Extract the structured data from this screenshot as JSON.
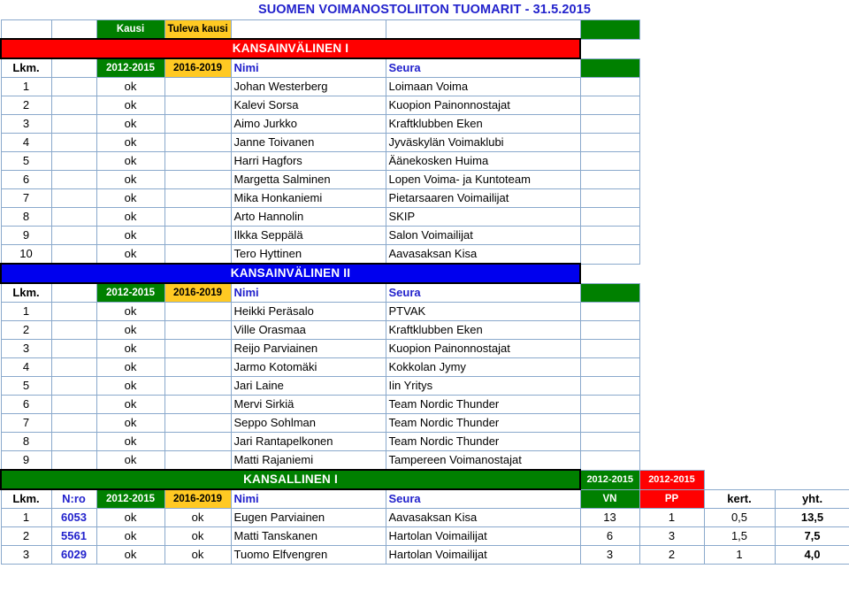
{
  "document": {
    "title": "SUOMEN VOIMANOSTOLIITON TUOMARIT - 31.5.2015"
  },
  "column_labels": {
    "lkm": "Lkm.",
    "nro": "N:ro",
    "kausi": "Kausi",
    "tuleva_kausi": "Tuleva kausi",
    "season_current": "2012-2015",
    "season_next": "2016-2019",
    "nimi": "Nimi",
    "seura": "Seura",
    "vn": "VN",
    "pp": "PP",
    "kert": "kert.",
    "yht": "yht.",
    "vn_season": "2012-2015",
    "pp_season": "2012-2015"
  },
  "colors": {
    "title_text": "#2222cc",
    "banner_red": "#ff0000",
    "banner_blue": "#0000ee",
    "banner_green": "#008000",
    "green": "#008000",
    "gold": "#ffc923",
    "red": "#ff0000",
    "grid": "#8aa9cc"
  },
  "sections": [
    {
      "id": "kansainvalinen-1",
      "banner": "KANSAINVÄLINEN I",
      "banner_style": "red",
      "rows": [
        {
          "lkm": "1",
          "kausi": "ok",
          "tuleva": "",
          "nimi": "Johan Westerberg",
          "seura": "Loimaan Voima"
        },
        {
          "lkm": "2",
          "kausi": "ok",
          "tuleva": "",
          "nimi": "Kalevi Sorsa",
          "seura": "Kuopion Painonnostajat"
        },
        {
          "lkm": "3",
          "kausi": "ok",
          "tuleva": "",
          "nimi": "Aimo Jurkko",
          "seura": "Kraftklubben Eken"
        },
        {
          "lkm": "4",
          "kausi": "ok",
          "tuleva": "",
          "nimi": "Janne Toivanen",
          "seura": "Jyväskylän Voimaklubi"
        },
        {
          "lkm": "5",
          "kausi": "ok",
          "tuleva": "",
          "nimi": "Harri Hagfors",
          "seura": "Äänekosken Huima"
        },
        {
          "lkm": "6",
          "kausi": "ok",
          "tuleva": "",
          "nimi": "Margetta Salminen",
          "seura": "Lopen Voima- ja Kuntoteam"
        },
        {
          "lkm": "7",
          "kausi": "ok",
          "tuleva": "",
          "nimi": "Mika Honkaniemi",
          "seura": "Pietarsaaren Voimailijat"
        },
        {
          "lkm": "8",
          "kausi": "ok",
          "tuleva": "",
          "nimi": "Arto Hannolin",
          "seura": "SKIP"
        },
        {
          "lkm": "9",
          "kausi": "ok",
          "tuleva": "",
          "nimi": "Ilkka Seppälä",
          "seura": "Salon Voimailijat"
        },
        {
          "lkm": "10",
          "kausi": "ok",
          "tuleva": "",
          "nimi": "Tero Hyttinen",
          "seura": "Aavasaksan Kisa"
        }
      ]
    },
    {
      "id": "kansainvalinen-2",
      "banner": "KANSAINVÄLINEN II",
      "banner_style": "blue",
      "rows": [
        {
          "lkm": "1",
          "kausi": "ok",
          "tuleva": "",
          "nimi": "Heikki Peräsalo",
          "seura": "PTVAK"
        },
        {
          "lkm": "2",
          "kausi": "ok",
          "tuleva": "",
          "nimi": "Ville Orasmaa",
          "seura": "Kraftklubben Eken"
        },
        {
          "lkm": "3",
          "kausi": "ok",
          "tuleva": "",
          "nimi": "Reijo Parviainen",
          "seura": "Kuopion Painonnostajat"
        },
        {
          "lkm": "4",
          "kausi": "ok",
          "tuleva": "",
          "nimi": "Jarmo Kotomäki",
          "seura": "Kokkolan Jymy"
        },
        {
          "lkm": "5",
          "kausi": "ok",
          "tuleva": "",
          "nimi": "Jari Laine",
          "seura": "Iin Yritys"
        },
        {
          "lkm": "6",
          "kausi": "ok",
          "tuleva": "",
          "nimi": "Mervi Sirkiä",
          "seura": "Team Nordic Thunder"
        },
        {
          "lkm": "7",
          "kausi": "ok",
          "tuleva": "",
          "nimi": "Seppo Sohlman",
          "seura": "Team Nordic Thunder"
        },
        {
          "lkm": "8",
          "kausi": "ok",
          "tuleva": "",
          "nimi": "Jari Rantapelkonen",
          "seura": "Team Nordic Thunder"
        },
        {
          "lkm": "9",
          "kausi": "ok",
          "tuleva": "",
          "nimi": "Matti Rajaniemi",
          "seura": "Tampereen Voimanostajat"
        }
      ]
    },
    {
      "id": "kansallinen-1",
      "banner": "KANSALLINEN I",
      "banner_style": "green",
      "rows": [
        {
          "lkm": "1",
          "nro": "6053",
          "kausi": "ok",
          "tuleva": "ok",
          "nimi": "Eugen Parviainen",
          "seura": "Aavasaksan Kisa",
          "vn": "13",
          "pp": "1",
          "kert": "0,5",
          "yht": "13,5"
        },
        {
          "lkm": "2",
          "nro": "5561",
          "kausi": "ok",
          "tuleva": "ok",
          "nimi": "Matti Tanskanen",
          "seura": "Hartolan Voimailijat",
          "vn": "6",
          "pp": "3",
          "kert": "1,5",
          "yht": "7,5"
        },
        {
          "lkm": "3",
          "nro": "6029",
          "kausi": "ok",
          "tuleva": "ok",
          "nimi": "Tuomo Elfvengren",
          "seura": "Hartolan Voimailijat",
          "vn": "3",
          "pp": "2",
          "kert": "1",
          "yht": "4,0"
        }
      ]
    }
  ]
}
